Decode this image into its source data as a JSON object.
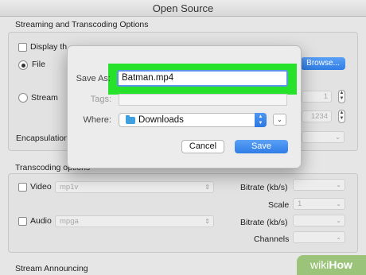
{
  "window": {
    "title": "Open Source"
  },
  "streaming": {
    "section_title": "Streaming and Transcoding Options",
    "display_label": "Display th",
    "file_label": "File",
    "browse_label": "Browse...",
    "stream_label": "Stream",
    "stream_value": "1",
    "stream_port": "1234",
    "encapsulation_label": "Encapsulation"
  },
  "transcoding": {
    "section_title": "Transcoding options",
    "video_label": "Video",
    "video_codec": "mp1v",
    "audio_label": "Audio",
    "audio_codec": "mpga",
    "bitrate_label": "Bitrate (kb/s)",
    "scale_label": "Scale",
    "scale_value": "1",
    "audio_bitrate_label": "Bitrate (kb/s)",
    "channels_label": "Channels"
  },
  "announcing": {
    "section_title": "Stream Announcing"
  },
  "save_dialog": {
    "save_as_label": "Save As:",
    "save_as_value": "Batman.mp4",
    "tags_label": "Tags:",
    "where_label": "Where:",
    "where_value": "Downloads",
    "cancel_label": "Cancel",
    "save_label": "Save",
    "highlight_color": "#27e22b",
    "accent_color": "#2f7de6"
  },
  "watermark": {
    "brand_light": "wiki",
    "brand_bold": "How"
  }
}
